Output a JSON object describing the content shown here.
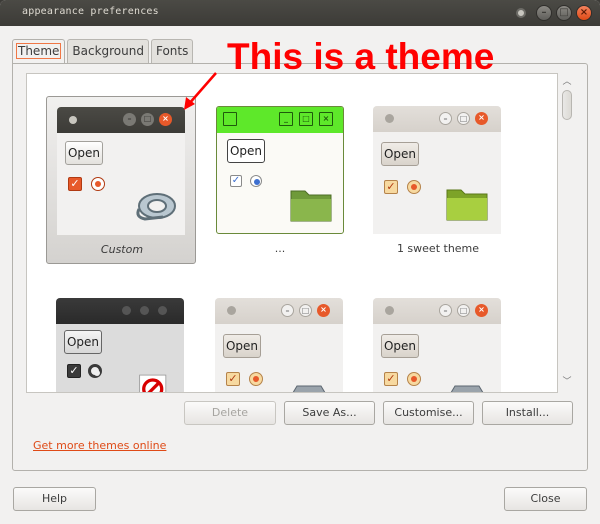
{
  "window": {
    "title": "appearance preferences"
  },
  "tabs": [
    {
      "label": "Theme",
      "active": true
    },
    {
      "label": "Background",
      "active": false
    },
    {
      "label": "Fonts",
      "active": false
    }
  ],
  "annotation": {
    "text": "This is a theme",
    "color": "#ff0000"
  },
  "themes": [
    {
      "name": "Custom",
      "selected": true,
      "style": "dark",
      "open_label": "Open"
    },
    {
      "name": "...",
      "selected": false,
      "style": "green",
      "open_label": "Open"
    },
    {
      "name": "1 sweet theme",
      "selected": false,
      "style": "light",
      "open_label": "Open"
    },
    {
      "name": "",
      "selected": false,
      "style": "gray",
      "open_label": "Open"
    },
    {
      "name": "",
      "selected": false,
      "style": "light",
      "open_label": "Open"
    },
    {
      "name": "",
      "selected": false,
      "style": "light",
      "open_label": "Open"
    }
  ],
  "actions": {
    "delete": "Delete",
    "save_as": "Save As...",
    "customise": "Customise...",
    "install": "Install..."
  },
  "link": {
    "get_more": "Get more themes online"
  },
  "footer": {
    "help": "Help",
    "close": "Close"
  },
  "colors": {
    "accent": "#df4a16",
    "titlebar": "#3c3b37",
    "green_theme": "#5ee82a"
  }
}
